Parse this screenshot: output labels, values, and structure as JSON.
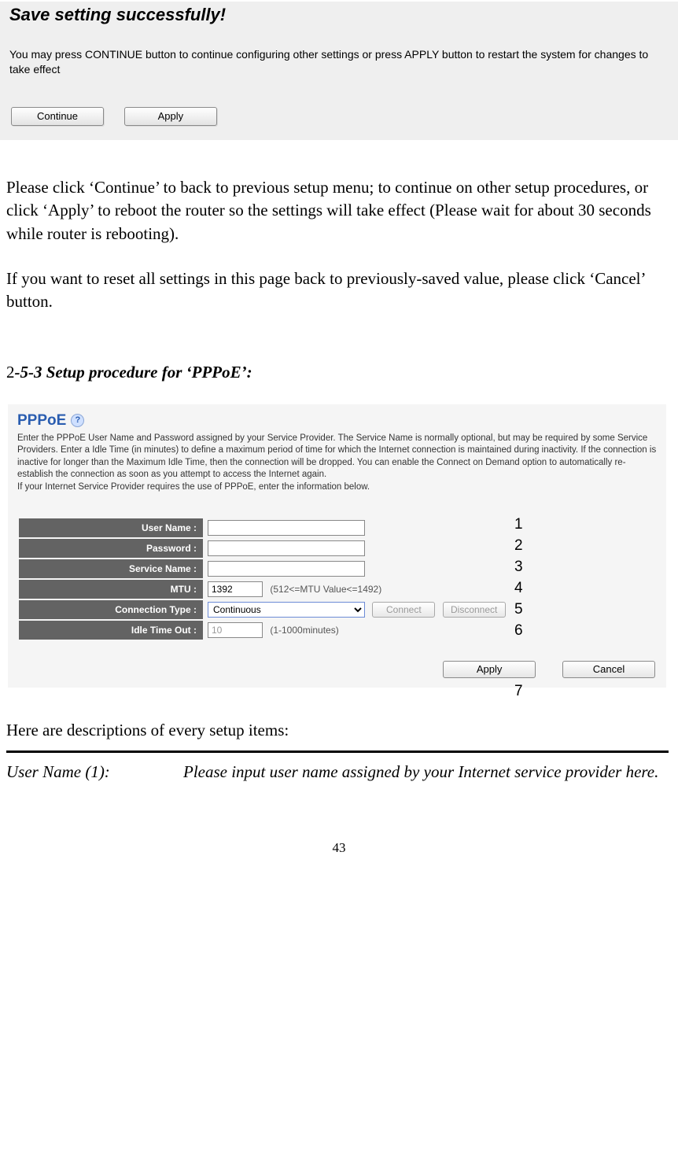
{
  "save_panel": {
    "title": "Save setting successfully!",
    "body": "You may press CONTINUE button to continue configuring other settings or press APPLY button to restart the system for changes to take effect",
    "continue_label": "Continue",
    "apply_label": "Apply"
  },
  "body_para1": "Please click ‘Continue’ to back to previous setup menu; to continue on other setup procedures, or click ‘Apply’ to reboot the router so the settings will take effect (Please wait for about 30 seconds while router is rebooting).",
  "body_para2": "If you want to reset all settings in this page back to previously-saved value, please click ‘Cancel’ button.",
  "section_heading_lead": "2",
  "section_heading_rest": "-5-3 Setup procedure for ‘PPPoE’:",
  "pppoe": {
    "title": "PPPoE",
    "help_glyph": "?",
    "description": "Enter the PPPoE User Name and Password assigned by your Service Provider. The Service Name is normally optional, but may be required by some Service Providers. Enter a Idle Time (in minutes) to define a maximum period of time for which the Internet connection is maintained during inactivity. If the connection is inactive for longer than the Maximum Idle Time, then the connection will be dropped. You can enable the Connect on Demand option to automatically re-establish the connection as soon as you attempt to access the Internet again.\nIf your Internet Service Provider requires the use of PPPoE, enter the information below.",
    "rows": {
      "user_name_label": "User Name :",
      "password_label": "Password :",
      "service_name_label": "Service Name :",
      "mtu_label": "MTU :",
      "mtu_value": "1392",
      "mtu_hint": "(512<=MTU Value<=1492)",
      "conn_type_label": "Connection Type :",
      "conn_type_value": "Continuous",
      "connect_btn": "Connect",
      "disconnect_btn": "Disconnect",
      "idle_label": "Idle Time Out :",
      "idle_value": "10",
      "idle_hint": "(1-1000minutes)"
    },
    "apply_label": "Apply",
    "cancel_label": "Cancel"
  },
  "callouts": {
    "c1": "1",
    "c2": "2",
    "c3": "3",
    "c4": "4",
    "c5": "5",
    "c6": "6",
    "c7": "7"
  },
  "desc_intro": "Here are descriptions of every setup items:",
  "desc1_label": "User Name (1):",
  "desc1_text": "Please input user name assigned by your Internet service provider here.",
  "page_number": "43"
}
